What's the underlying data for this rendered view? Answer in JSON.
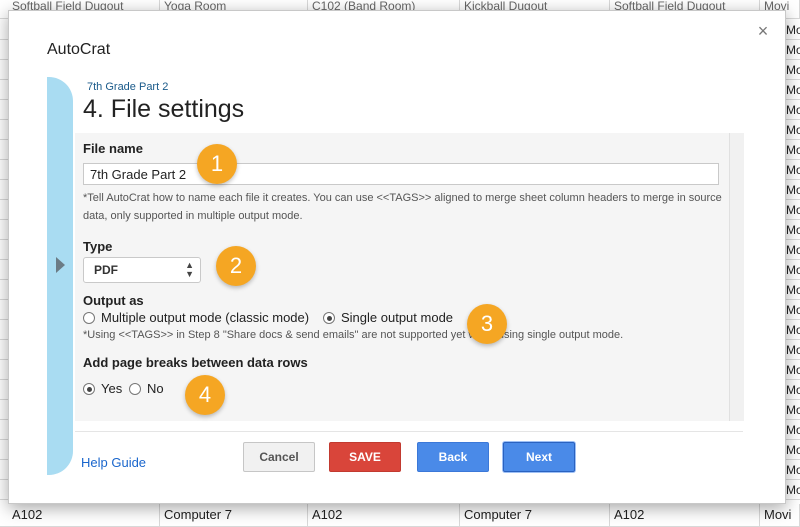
{
  "sheet": {
    "top_row": [
      "Softball Field Dugout",
      "Yoga Room",
      "C102 (Band Room)",
      "Kickball Dugout",
      "Softball Field Dugout",
      "Movi"
    ],
    "bottom_row": [
      "A102",
      "Computer 7",
      "A102",
      "Computer 7",
      "A102",
      "Movi"
    ],
    "right_col": [
      "Movi",
      "Movi",
      "Movi",
      "Movi",
      "Movi",
      "Movi",
      "Movi",
      "Movi",
      "Movi",
      "Movi",
      "Movi",
      "Movi",
      "Movi",
      "Movi",
      "Movi",
      "Movi",
      "Movi",
      "Movi",
      "Movi",
      "Movi",
      "Movi",
      "Movi",
      "Movi",
      "Movi"
    ]
  },
  "dialog": {
    "app_title": "AutoCrat",
    "close_glyph": "×",
    "breadcrumb": "7th Grade Part 2",
    "step_title": "4. File settings"
  },
  "file_name": {
    "label": "File name",
    "value": "7th Grade Part 2",
    "help_line1": "*Tell AutoCrat how to name each file it creates. You can use <<TAGS>> aligned to merge sheet column headers to merge in source",
    "help_line2": "data, only supported in multiple output mode."
  },
  "type": {
    "label": "Type",
    "selected": "PDF",
    "arrows": "▲▼"
  },
  "output_as": {
    "label": "Output as",
    "options": [
      {
        "label": "Multiple output mode (classic mode)",
        "checked": false
      },
      {
        "label": "Single output mode",
        "checked": true
      }
    ],
    "help": "*Using <<TAGS>> in Step 8 \"Share docs & send emails\" are not supported yet when using single output mode."
  },
  "page_breaks": {
    "label": "Add page breaks between data rows",
    "options": [
      {
        "label": "Yes",
        "checked": true
      },
      {
        "label": "No",
        "checked": false
      }
    ]
  },
  "badges": [
    "1",
    "2",
    "3",
    "4"
  ],
  "footer": {
    "help_link": "Help Guide",
    "cancel": "Cancel",
    "save": "SAVE",
    "back": "Back",
    "next": "Next"
  }
}
